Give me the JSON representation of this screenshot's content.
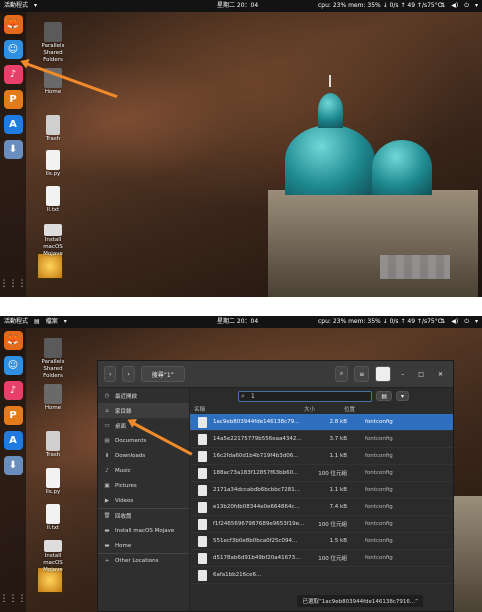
{
  "top_panel": {
    "activities": "活動程式",
    "app_menu": "檔案",
    "clock": "星期二 20：04",
    "system_stats": "cpu: 23% mem: 35% ↓ 0/s ↑ 49 ↑/s75°C"
  },
  "dock": {
    "items": [
      {
        "name": "firefox",
        "glyph": "🦊",
        "color": "#e5691a"
      },
      {
        "name": "finder",
        "glyph": "☺",
        "color": "#2f8fe0"
      },
      {
        "name": "itunes",
        "glyph": "♪",
        "color": "#ea3f6a"
      },
      {
        "name": "presentation",
        "glyph": "P",
        "color": "#e37a1b"
      },
      {
        "name": "app-store",
        "glyph": "A",
        "color": "#1f7be0"
      },
      {
        "name": "installer",
        "glyph": "⬇",
        "color": "#6a8fbf"
      }
    ],
    "apps_grid": "⋮⋮⋮"
  },
  "desktop_icons": [
    {
      "label": "Parallels Shared Folders"
    },
    {
      "label": "Home"
    },
    {
      "label": "Trash"
    },
    {
      "label": "lls.py"
    },
    {
      "label": "ll.txt"
    },
    {
      "label": "Install macOS Mojave"
    }
  ],
  "file_manager": {
    "search_title": "搜尋“1”",
    "search_value": "1",
    "columns": {
      "name": "名稱",
      "size": "大小",
      "location": "位置"
    },
    "sidebar": [
      {
        "label": "最近開啟",
        "icon": "◷"
      },
      {
        "label": "家目錄",
        "icon": "⌂"
      },
      {
        "label": "桌面",
        "icon": "▭"
      },
      {
        "label": "Documents",
        "icon": "▤"
      },
      {
        "label": "Downloads",
        "icon": "⬇"
      },
      {
        "label": "Music",
        "icon": "♪"
      },
      {
        "label": "Pictures",
        "icon": "▣"
      },
      {
        "label": "Videos",
        "icon": "▶"
      },
      {
        "label": "回收筒",
        "icon": "🗑"
      },
      {
        "label": "Install macOS Mojave",
        "icon": "▬"
      },
      {
        "label": "Home",
        "icon": "▬"
      },
      {
        "label": "Other Locations",
        "icon": "+"
      }
    ],
    "rows": [
      {
        "name": "1ac9eb803944fde146138c79...",
        "size": "2.8 kB",
        "location": "fontconfig"
      },
      {
        "name": "14a5e22175779b556eaa4342...",
        "size": "3.7 kB",
        "location": "fontconfig"
      },
      {
        "name": "16c2fda60d1b4b719f4b3d06...",
        "size": "1.1 kB",
        "location": "fontconfig"
      },
      {
        "name": "188ac73a183f12857f63bb60...",
        "size": "100 位元組",
        "location": "fontconfig"
      },
      {
        "name": "2171a34dccabdb6bcbbc7281...",
        "size": "1.1 kB",
        "location": "fontconfig"
      },
      {
        "name": "e13b20fdb08344e0e664864c...",
        "size": "7.4 kB",
        "location": "fontconfig"
      },
      {
        "name": "f1f24656967987689e9653f19e...",
        "size": "100 位元組",
        "location": "fontconfig"
      },
      {
        "name": "551ecf3b0e8b0bca0f25c094...",
        "size": "1.5 kB",
        "location": "fontconfig"
      },
      {
        "name": "d5178ab6d91b49bf20a41673...",
        "size": "100 位元組",
        "location": "fontconfig"
      },
      {
        "name": "6afa1bb216ce6...",
        "size": "",
        "location": ""
      }
    ],
    "status": "已選取“1ac9eb803944fde146138c7916...”"
  }
}
